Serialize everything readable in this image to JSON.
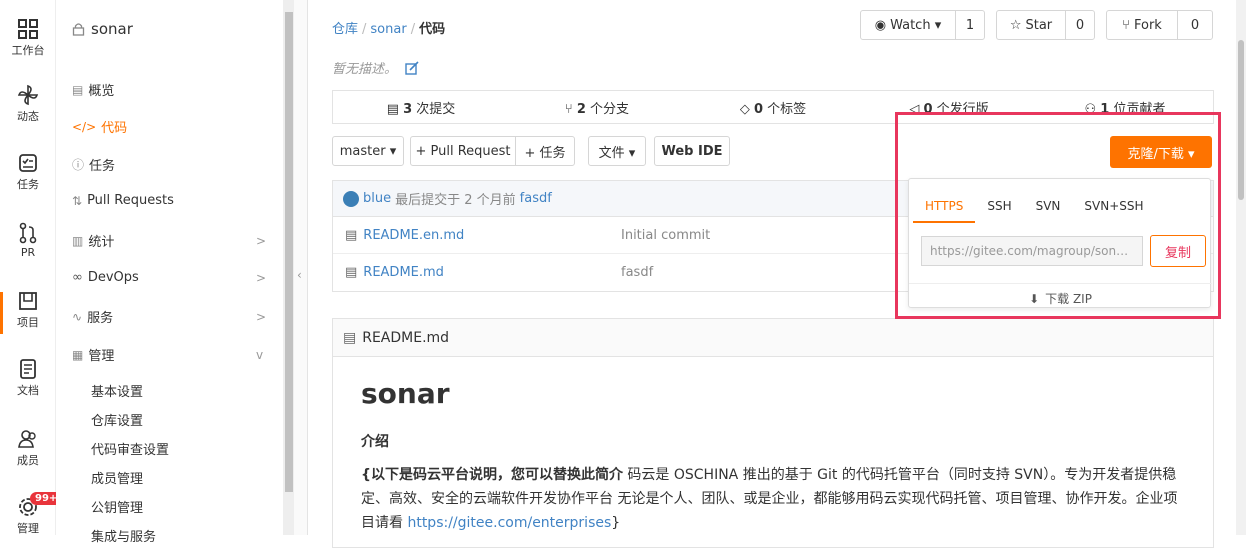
{
  "rail": [
    {
      "label": "工作台",
      "icon": "grid-icon"
    },
    {
      "label": "动态",
      "icon": "pinwheel-icon"
    },
    {
      "label": "任务",
      "icon": "task-icon"
    },
    {
      "label": "PR",
      "icon": "pull-request-icon"
    },
    {
      "label": "项目",
      "icon": "project-icon"
    },
    {
      "label": "文档",
      "icon": "doc-icon"
    },
    {
      "label": "成员",
      "icon": "members-icon"
    },
    {
      "label": "管理",
      "icon": "settings-icon",
      "badge": "99+"
    }
  ],
  "sidebar": {
    "repo_name": "sonar",
    "items": [
      {
        "label": "概览"
      },
      {
        "label": "代码"
      },
      {
        "label": "任务"
      },
      {
        "label": "Pull Requests"
      },
      {
        "label": "统计",
        "chevron": ">"
      },
      {
        "label": "DevOps",
        "chevron": ">"
      },
      {
        "label": "服务",
        "chevron": ">"
      },
      {
        "label": "管理",
        "chevron": "v"
      }
    ],
    "sub_items": [
      "基本设置",
      "仓库设置",
      "代码审查设置",
      "成员管理",
      "公钥管理",
      "集成与服务"
    ]
  },
  "breadcrumb": {
    "root": "仓库",
    "repo": "sonar",
    "current": "代码",
    "sep": "/"
  },
  "actions": {
    "watch_label": "Watch ▾",
    "watch_count": "1",
    "star_label": "Star",
    "star_count": "0",
    "fork_label": "Fork",
    "fork_count": "0"
  },
  "description": "暂无描述。",
  "stats": [
    {
      "num": "3",
      "label": "次提交"
    },
    {
      "num": "2",
      "label": "个分支"
    },
    {
      "num": "0",
      "label": "个标签"
    },
    {
      "num": "0",
      "label": "个发行版"
    },
    {
      "num": "1",
      "label": "位贡献者"
    }
  ],
  "toolbar": {
    "branch": "master ▾",
    "pull_request": "+ Pull Request",
    "task": "+ 任务",
    "file": "文件 ▾",
    "webide": "Web IDE",
    "clone": "克隆/下载 ▾"
  },
  "last_commit": {
    "author": "blue",
    "text": "最后提交于 2 个月前",
    "message": "fasdf"
  },
  "files": [
    {
      "name": "README.en.md",
      "msg": "Initial commit"
    },
    {
      "name": "README.md",
      "msg": "fasdf"
    }
  ],
  "clone_popup": {
    "tabs": [
      "HTTPS",
      "SSH",
      "SVN",
      "SVN+SSH"
    ],
    "url": "https://gitee.com/magroup/sonar.git",
    "copy_label": "复制",
    "zip_label": "下载 ZIP"
  },
  "readme": {
    "file": "README.md",
    "title": "sonar",
    "intro_heading": "介绍",
    "intro_bold": "{以下是码云平台说明，您可以替换此简介",
    "intro_text": " 码云是 OSCHINA 推出的基于 Git 的代码托管平台（同时支持 SVN）。专为开发者提供稳定、高效、安全的云端软件开发协作平台 无论是个人、团队、或是企业，都能够用码云实现代码托管、项目管理、协作开发。企业项目请看 ",
    "intro_link": "https://gitee.com/enterprises",
    "intro_end": "}"
  },
  "colors": {
    "accent": "#fe7300",
    "link": "#4183c4",
    "highlight": "#e8365d"
  }
}
